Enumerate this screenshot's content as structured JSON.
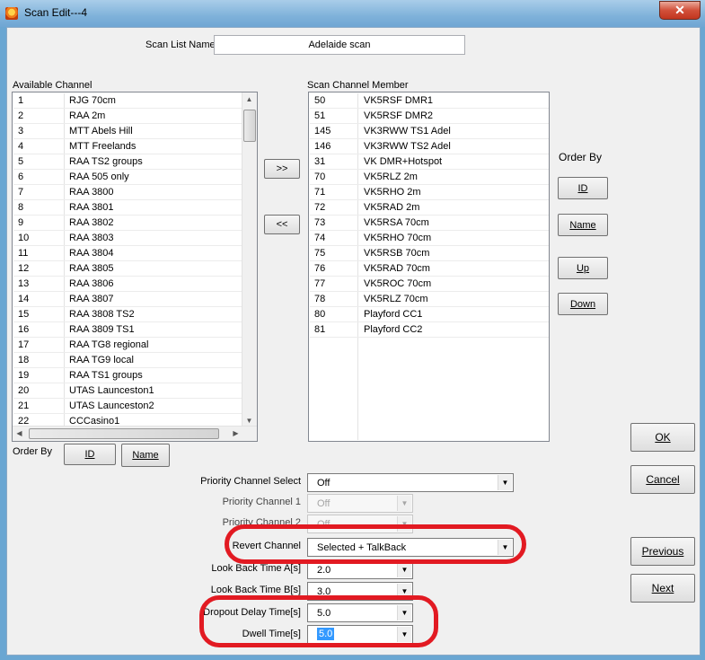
{
  "window": {
    "title": "Scan Edit---4",
    "close_glyph": "✕"
  },
  "scan_list_name": {
    "label": "Scan List Name",
    "value": "Adelaide scan"
  },
  "available": {
    "label": "Available Channel",
    "rows": [
      {
        "id": "1",
        "name": "RJG 70cm"
      },
      {
        "id": "2",
        "name": "RAA 2m"
      },
      {
        "id": "3",
        "name": "MTT Abels Hill"
      },
      {
        "id": "4",
        "name": "MTT Freelands"
      },
      {
        "id": "5",
        "name": "RAA TS2 groups"
      },
      {
        "id": "6",
        "name": "RAA 505 only"
      },
      {
        "id": "7",
        "name": "RAA 3800"
      },
      {
        "id": "8",
        "name": "RAA 3801"
      },
      {
        "id": "9",
        "name": "RAA 3802"
      },
      {
        "id": "10",
        "name": "RAA 3803"
      },
      {
        "id": "11",
        "name": "RAA 3804"
      },
      {
        "id": "12",
        "name": "RAA 3805"
      },
      {
        "id": "13",
        "name": "RAA 3806"
      },
      {
        "id": "14",
        "name": "RAA 3807"
      },
      {
        "id": "15",
        "name": "RAA 3808 TS2"
      },
      {
        "id": "16",
        "name": "RAA 3809 TS1"
      },
      {
        "id": "17",
        "name": "RAA TG8 regional"
      },
      {
        "id": "18",
        "name": "RAA TG9 local"
      },
      {
        "id": "19",
        "name": "RAA TS1 groups"
      },
      {
        "id": "20",
        "name": "UTAS Launceston1"
      },
      {
        "id": "21",
        "name": "UTAS Launceston2"
      },
      {
        "id": "22",
        "name": "CCCasino1"
      }
    ],
    "order_by_label": "Order By",
    "order_id": "ID",
    "order_name": "Name"
  },
  "members": {
    "label": "Scan Channel Member",
    "rows": [
      {
        "id": "50",
        "name": "VK5RSF DMR1"
      },
      {
        "id": "51",
        "name": "VK5RSF DMR2"
      },
      {
        "id": "145",
        "name": "VK3RWW TS1 Adel"
      },
      {
        "id": "146",
        "name": "VK3RWW TS2 Adel"
      },
      {
        "id": "31",
        "name": "VK DMR+Hotspot"
      },
      {
        "id": "70",
        "name": "VK5RLZ 2m"
      },
      {
        "id": "71",
        "name": "VK5RHO 2m"
      },
      {
        "id": "72",
        "name": "VK5RAD 2m"
      },
      {
        "id": "73",
        "name": "VK5RSA 70cm"
      },
      {
        "id": "74",
        "name": "VK5RHO 70cm"
      },
      {
        "id": "75",
        "name": "VK5RSB 70cm"
      },
      {
        "id": "76",
        "name": "VK5RAD 70cm"
      },
      {
        "id": "77",
        "name": "VK5ROC 70cm"
      },
      {
        "id": "78",
        "name": "VK5RLZ 70cm"
      },
      {
        "id": "80",
        "name": "Playford CC1"
      },
      {
        "id": "81",
        "name": "Playford CC2"
      }
    ]
  },
  "transfer": {
    "add": ">>",
    "remove": "<<"
  },
  "member_order": {
    "label": "Order By",
    "id": "ID",
    "name": "Name",
    "up": "Up",
    "down": "Down"
  },
  "fields": {
    "priority_select": {
      "label": "Priority Channel Select",
      "value": "Off"
    },
    "priority1": {
      "label": "Priority Channel 1",
      "value": "Off"
    },
    "priority2": {
      "label": "Priority Channel 2",
      "value": "Off"
    },
    "revert": {
      "label": "Revert Channel",
      "value": "Selected + TalkBack"
    },
    "lookback_a": {
      "label": "Look Back Time A[s]",
      "value": "2.0"
    },
    "lookback_b": {
      "label": "Look Back Time B[s]",
      "value": "3.0"
    },
    "dropout": {
      "label": "Dropout Delay Time[s]",
      "value": "5.0"
    },
    "dwell": {
      "label": "Dwell Time[s]",
      "value": "5.0"
    }
  },
  "dialog_buttons": {
    "ok": "OK",
    "cancel": "Cancel",
    "previous": "Previous",
    "next": "Next"
  },
  "colors": {
    "annotation": "#e21a22",
    "selection": "#3399ff"
  }
}
